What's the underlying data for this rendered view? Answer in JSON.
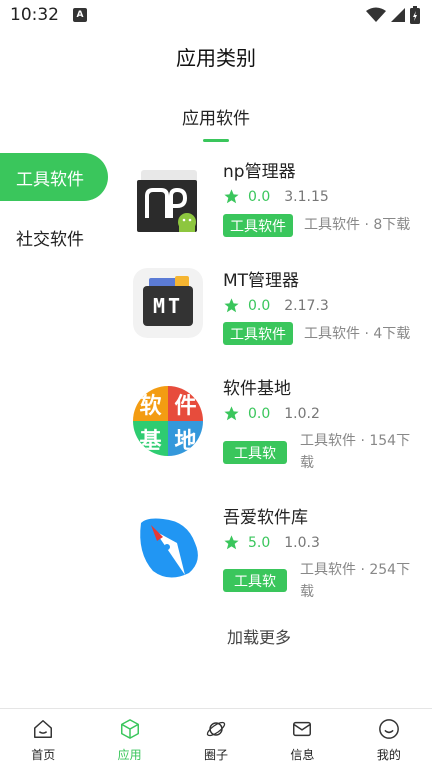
{
  "status_bar": {
    "time": "10:32",
    "notification_letter": "A"
  },
  "page_title": "应用类别",
  "tab": {
    "label": "应用软件"
  },
  "categories": [
    {
      "label": "工具软件",
      "active": true
    },
    {
      "label": "社交软件",
      "active": false
    }
  ],
  "apps": [
    {
      "name": "np管理器",
      "rating": "0.0",
      "version": "3.1.15",
      "tag": "工具软件",
      "meta": "工具软件 · 8下载",
      "icon": "np-manager-icon"
    },
    {
      "name": "MT管理器",
      "rating": "0.0",
      "version": "2.17.3",
      "tag": "工具软件",
      "meta": "工具软件 · 4下载",
      "icon": "mt-manager-icon",
      "icon_text": "MT"
    },
    {
      "name": "软件基地",
      "rating": "0.0",
      "version": "1.0.2",
      "tag": "工具软",
      "meta": "工具软件 · 154下载",
      "icon": "software-base-icon",
      "icon_chars": [
        "软",
        "件",
        "基",
        "地"
      ]
    },
    {
      "name": "吾爱软件库",
      "rating": "5.0",
      "version": "1.0.3",
      "tag": "工具软",
      "meta": "工具软件 · 254下载",
      "icon": "52pojie-icon"
    }
  ],
  "load_more": "加载更多",
  "bottom_nav": [
    {
      "label": "首页",
      "icon": "home-icon",
      "active": false
    },
    {
      "label": "应用",
      "icon": "cube-icon",
      "active": true
    },
    {
      "label": "圈子",
      "icon": "planet-icon",
      "active": false
    },
    {
      "label": "信息",
      "icon": "message-icon",
      "active": false
    },
    {
      "label": "我的",
      "icon": "smile-icon",
      "active": false
    }
  ],
  "colors": {
    "accent": "#3ac65c",
    "text": "#222222",
    "muted": "#888888"
  }
}
